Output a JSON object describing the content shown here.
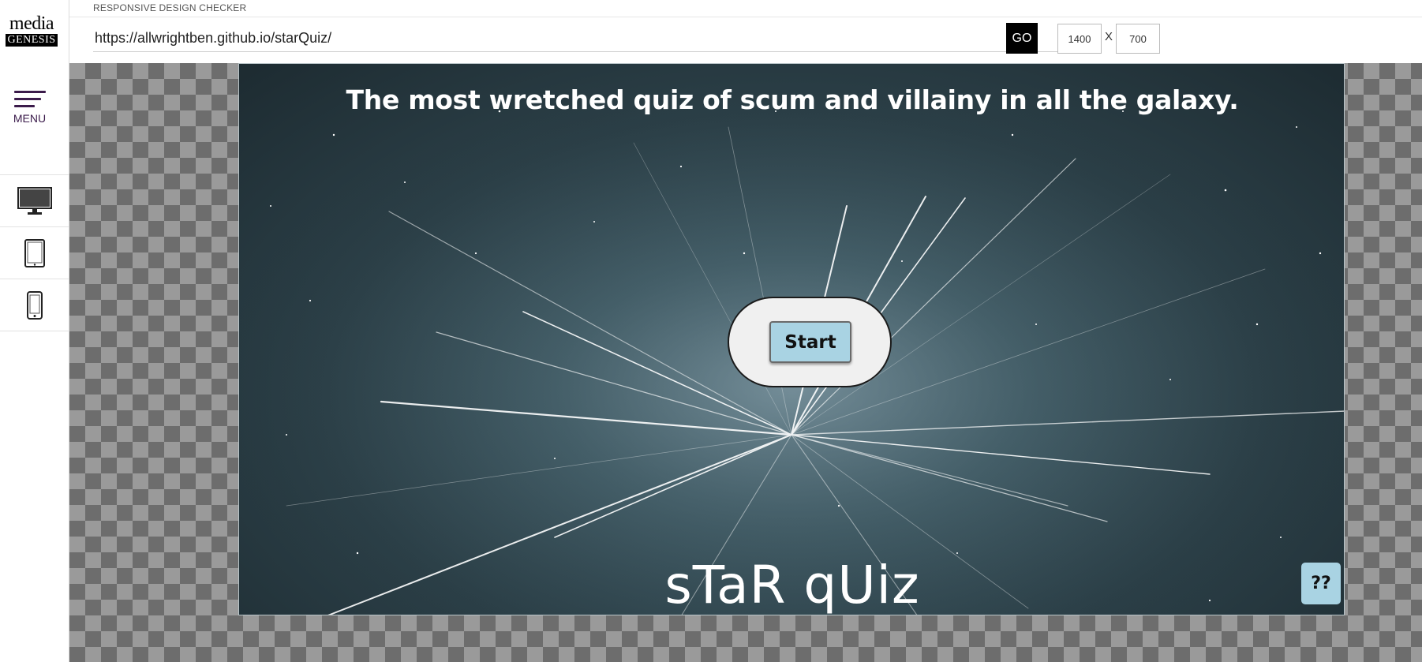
{
  "app": {
    "title": "RESPONSIVE DESIGN CHECKER",
    "logo": {
      "line1": "media",
      "line2": "GENESIS"
    }
  },
  "sidebar": {
    "menu_label": "MENU",
    "devices": [
      {
        "name": "desktop",
        "icon": "desktop-monitor-icon"
      },
      {
        "name": "tablet",
        "icon": "tablet-icon"
      },
      {
        "name": "phone",
        "icon": "mobile-phone-icon"
      }
    ]
  },
  "toolbar": {
    "url_value": "https://allwrightben.github.io/starQuiz/",
    "go_label": "GO",
    "width_value": "1400",
    "height_value": "700",
    "separator": "X"
  },
  "preview": {
    "headline": "The most wretched quiz of scum and villainy in all the galaxy.",
    "start_label": "Start",
    "brand_title": "sTaR qUiz",
    "help_label": "??",
    "colors": {
      "button_bg": "#a9d3e3",
      "pill_bg": "#f0f0f0",
      "space_bg": "#2b3f47"
    }
  }
}
